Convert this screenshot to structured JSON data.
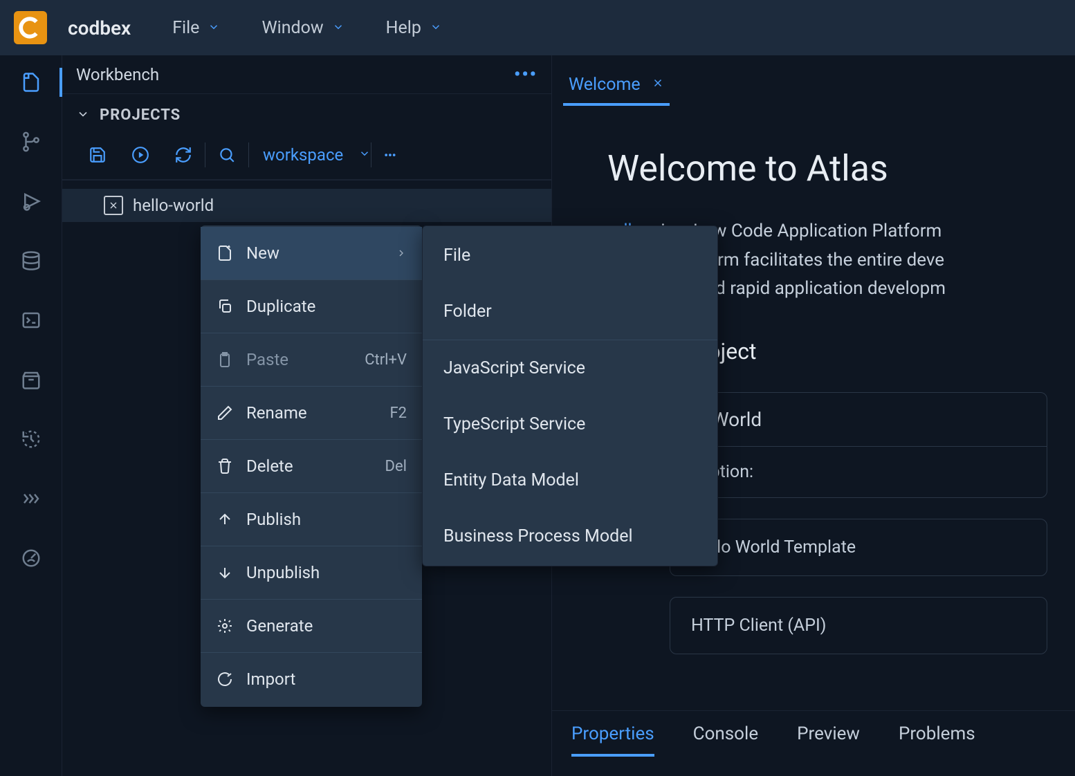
{
  "brand": "codbex",
  "topMenu": [
    "File",
    "Window",
    "Help"
  ],
  "sidebar": {
    "title": "Workbench",
    "projectsLabel": "PROJECTS",
    "workspaceLabel": "workspace",
    "projectName": "hello-world"
  },
  "contextMenu": {
    "new": "New",
    "duplicate": "Duplicate",
    "paste": "Paste",
    "pasteShortcut": "Ctrl+V",
    "rename": "Rename",
    "renameShortcut": "F2",
    "delete": "Delete",
    "deleteShortcut": "Del",
    "publish": "Publish",
    "unpublish": "Unpublish",
    "generate": "Generate",
    "import": "Import"
  },
  "submenu": {
    "file": "File",
    "folder": "Folder",
    "jsService": "JavaScript Service",
    "tsService": "TypeScript Service",
    "entityModel": "Entity Data Model",
    "bpModel": "Business Process Model"
  },
  "editor": {
    "tabLabel": "Welcome",
    "welcomeTitle": "Welcome to Atlas",
    "welcomeText1": "odbex",
    "welcomeText2": " is a Low Code Application Platform",
    "welcomeText3": "nt. This platform facilitates the entire deve",
    "welcomeText4": "ng models and rapid application developm",
    "createProject": "e a new project",
    "helloWorldHeader": "lo World",
    "descriptionLabel": "cription:",
    "template1": "Hello World Template",
    "template2": "HTTP Client (API)"
  },
  "bottomTabs": [
    "Properties",
    "Console",
    "Preview",
    "Problems"
  ],
  "colors": {
    "accent": "#4a9eff",
    "brand": "#e89312",
    "bg": "#0e1622",
    "panel": "#273749"
  }
}
